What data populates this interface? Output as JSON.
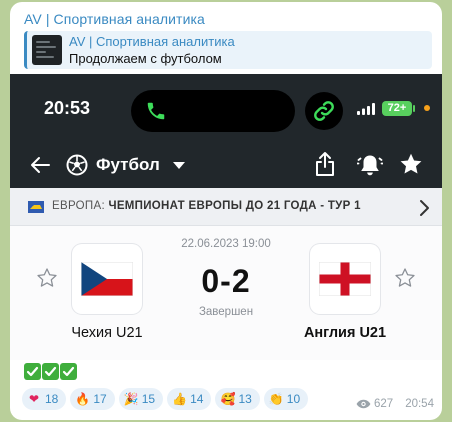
{
  "message": {
    "channel_name": "AV | Спортивная аналитика",
    "reply": {
      "title": "AV | Спортивная аналитика",
      "text": "Продолжаем с футболом"
    },
    "emoji_line": [
      "check",
      "check",
      "check"
    ],
    "views": "627",
    "time": "20:54"
  },
  "phone": {
    "status_time": "20:53",
    "battery": "72+",
    "colors": {
      "bar": "#21272b",
      "accent_green": "#58cf5e",
      "call_green": "#3ddc5a"
    }
  },
  "app": {
    "nav_title": "Футбол",
    "icons": [
      "back-arrow-icon",
      "soccer-ball-icon",
      "dropdown-caret-icon",
      "share-icon",
      "bell-icon",
      "star-icon"
    ]
  },
  "league": {
    "region": "ЕВРОПА:",
    "competition": "ЧЕМПИОНАТ ЕВРОПЫ ДО 21 ГОДА - ТУР 1"
  },
  "match": {
    "datetime": "22.06.2023 19:00",
    "score": "0-2",
    "status": "Завершен",
    "home": {
      "name": "Чехия U21",
      "flag": "czech-flag"
    },
    "away": {
      "name": "Англия U21",
      "flag": "england-flag"
    }
  },
  "reactions": [
    {
      "emoji": "❤",
      "icon": "heart",
      "count": "18"
    },
    {
      "emoji": "🔥",
      "icon": "fire",
      "count": "17"
    },
    {
      "emoji": "🎉",
      "icon": "party-popper",
      "count": "15"
    },
    {
      "emoji": "👍",
      "icon": "thumbs-up",
      "count": "14"
    },
    {
      "emoji": "🥰",
      "icon": "smiling-face-hearts",
      "count": "13"
    },
    {
      "emoji": "👏",
      "icon": "clapping-hands",
      "count": "10"
    }
  ]
}
